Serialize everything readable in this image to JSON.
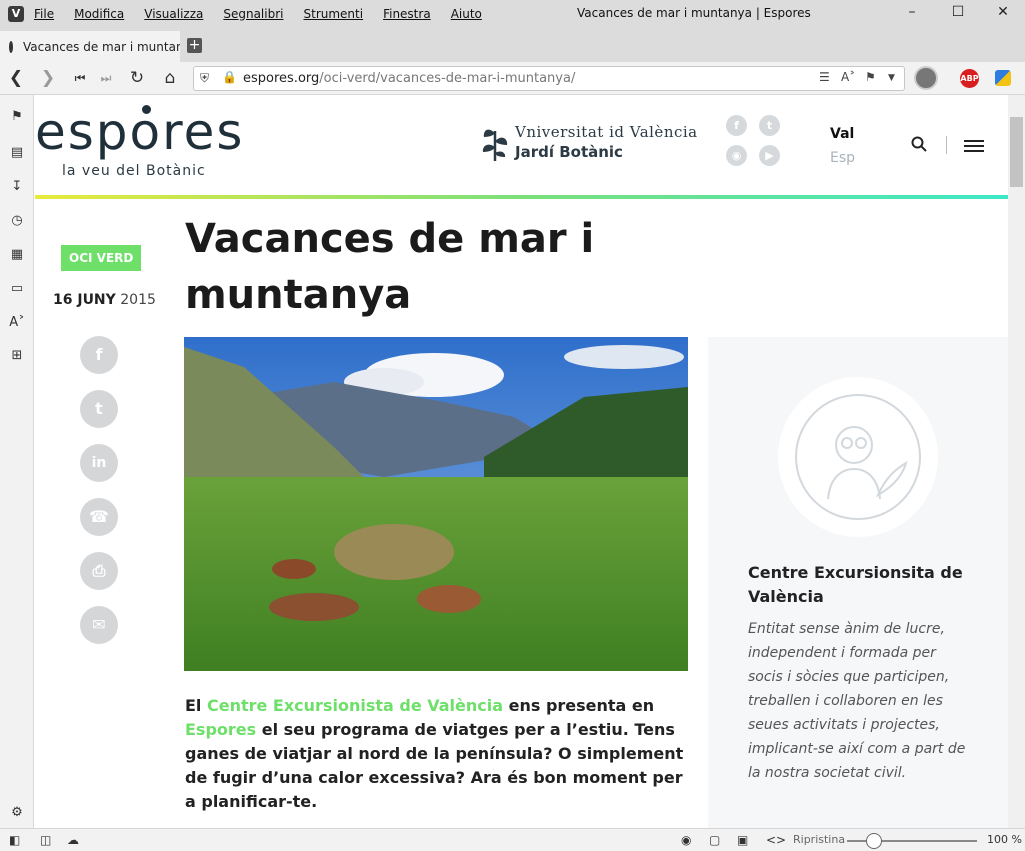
{
  "browser": {
    "menu": [
      "File",
      "Modifica",
      "Visualizza",
      "Segnalibri",
      "Strumenti",
      "Finestra",
      "Aiuto"
    ],
    "window_title": "Vacances de mar i muntanya | Espores",
    "tab_title": "Vacances de mar i muntanya | Espores",
    "url_domain": "espores.org",
    "url_path": "/oci-verd/vacances-de-mar-i-muntanya/",
    "status_reset": "Ripristina",
    "zoom": "100 %",
    "zoom_level": 100
  },
  "header": {
    "logo": "espores",
    "tagline": "la veu del Botànic",
    "uv_title": "Vniversitat id València",
    "uv_subtitle": "Jardí Botànic",
    "lang_active": "Val",
    "lang_other": "Esp"
  },
  "article": {
    "category": "OCI VERD",
    "date_day": "16 JUNY",
    "date_year": "2015",
    "title": "Vacances de mar i muntanya",
    "intro_1": "El ",
    "intro_link_1": "Centre Excursionista de València",
    "intro_2": " ens presenta en ",
    "intro_link_2": "Espores",
    "intro_3": " el seu programa de viatges per a l’estiu. Tens ganes de viatjar al nord de la península? O simplement de fugir d’una calor excessiva? Ara és bon moment per a planificar-te."
  },
  "aside": {
    "title": "Centre Excursionsita de València",
    "description": "Entitat sense ànim de lucre, independent i formada per socis i sòcies que participen, treballen i collaboren en les seues activitats i projectes, implicant-se així com a part de la nostra societat civil."
  },
  "colors": {
    "accent_green": "#6ee06a",
    "dark": "#20303a"
  }
}
